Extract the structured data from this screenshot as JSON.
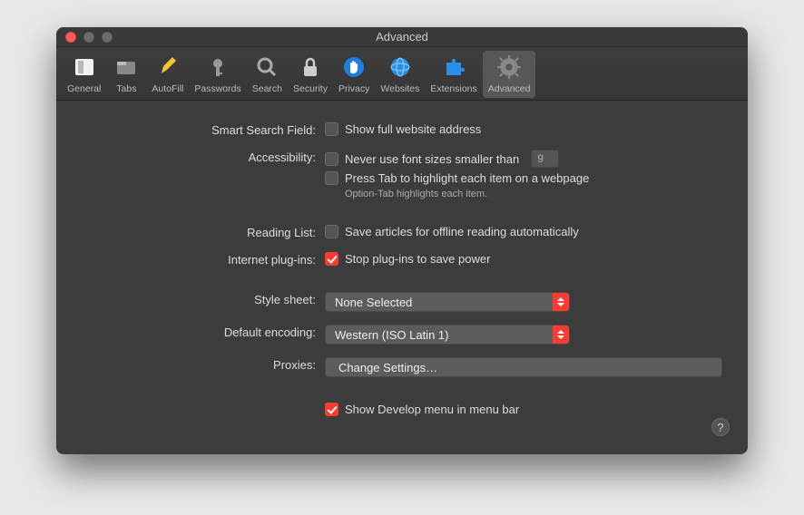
{
  "window": {
    "title": "Advanced"
  },
  "toolbar": {
    "items": [
      {
        "label": "General"
      },
      {
        "label": "Tabs"
      },
      {
        "label": "AutoFill"
      },
      {
        "label": "Passwords"
      },
      {
        "label": "Search"
      },
      {
        "label": "Security"
      },
      {
        "label": "Privacy"
      },
      {
        "label": "Websites"
      },
      {
        "label": "Extensions"
      },
      {
        "label": "Advanced"
      }
    ]
  },
  "sections": {
    "smart_search": {
      "label": "Smart Search Field:",
      "opt1": "Show full website address"
    },
    "accessibility": {
      "label": "Accessibility:",
      "opt1": "Never use font sizes smaller than",
      "font_size": "9",
      "opt2": "Press Tab to highlight each item on a webpage",
      "hint": "Option-Tab highlights each item."
    },
    "reading_list": {
      "label": "Reading List:",
      "opt1": "Save articles for offline reading automatically"
    },
    "plugins": {
      "label": "Internet plug-ins:",
      "opt1": "Stop plug-ins to save power"
    },
    "style_sheet": {
      "label": "Style sheet:",
      "value": "None Selected"
    },
    "encoding": {
      "label": "Default encoding:",
      "value": "Western (ISO Latin 1)"
    },
    "proxies": {
      "label": "Proxies:",
      "button": "Change Settings…"
    },
    "develop": {
      "opt1": "Show Develop menu in menu bar"
    }
  },
  "help": "?"
}
